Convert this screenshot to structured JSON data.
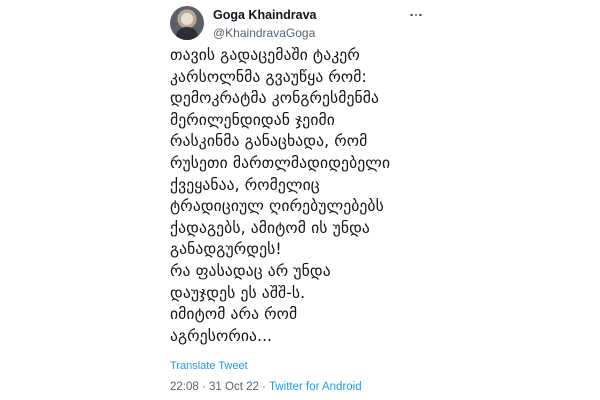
{
  "author": {
    "display_name": "Goga Khaindrava",
    "handle": "@KhaindravaGoga"
  },
  "tweet": {
    "lines": [
      "თავის გადაცემაში ტაკერ",
      "კარსოლნმა გვაუწყა რომ:",
      "დემოკრატმა კონგრესმენმა",
      "მერილენდიდან ჯეიმი",
      "რასკინმა განაცხადა, რომ",
      "რუსეთი მართლმადიდებელი",
      "ქვეყანაა, რომელიც",
      "ტრადიციულ ღირებულებებს",
      "ქადაგებს, ამიტომ ის უნდა",
      "განადგურდეს!",
      "რა ფასადაც არ უნდა",
      "დაუჯდეს ეს აშშ-ს.",
      "იმიტომ არა რომ",
      "აგრესორია..."
    ],
    "translate_label": "Translate Tweet",
    "time": "22:08",
    "date": "31 Oct 22",
    "separator": "·",
    "source": "Twitter for Android"
  },
  "icons": {
    "more": "more-dots-icon",
    "avatar": "profile-photo"
  },
  "colors": {
    "text": "#0f1419",
    "secondary": "#536471",
    "link": "#1d9bf0"
  }
}
